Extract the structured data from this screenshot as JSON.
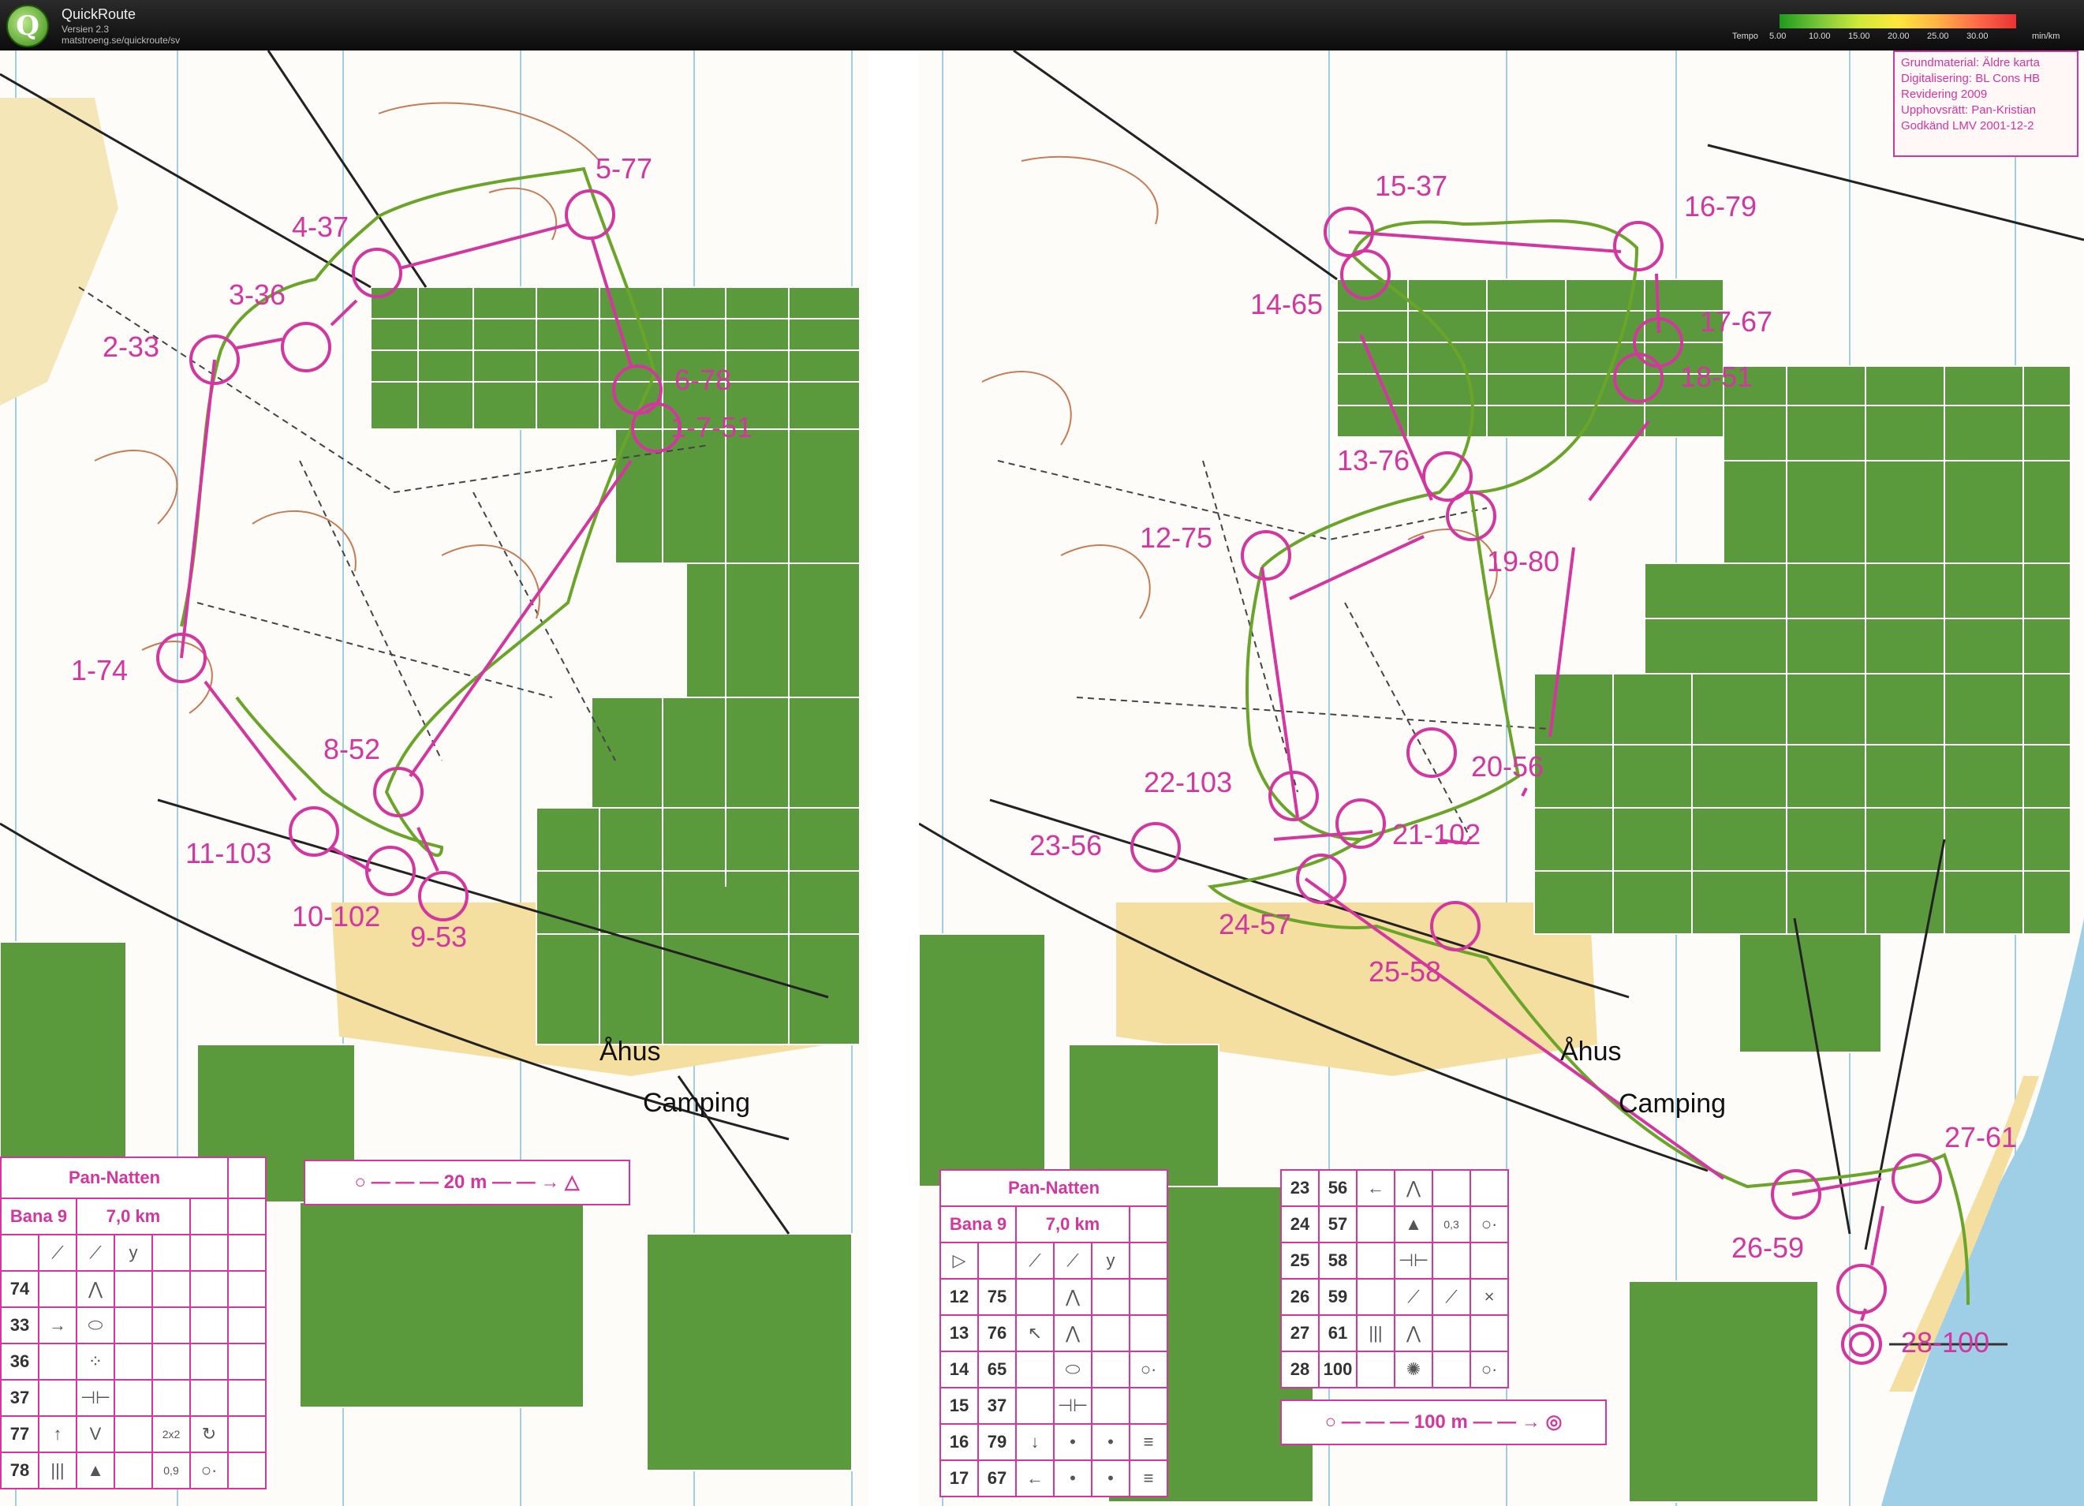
{
  "app": {
    "name": "QuickRoute",
    "version": "Versien 2.3",
    "url": "matstroeng.se/quickroute/sv",
    "logo_letter": "Q"
  },
  "tempo_scale": {
    "label": "Tempo",
    "ticks": [
      "5.00",
      "10.00",
      "15.00",
      "20.00",
      "25.00",
      "30.00"
    ],
    "unit": "min/km"
  },
  "colors": {
    "course_overprint": "#d4369f",
    "route_track": "#6aa52a",
    "forest_green": "#5b9a3c",
    "contour": "#c77b55",
    "water": "#9fcfe6",
    "yellow_open": "#f5dfa0"
  },
  "map_left": {
    "controls": [
      "1-74",
      "2-33",
      "3-36",
      "4-37",
      "5-77",
      "6-78",
      "1-7-51",
      "8-52",
      "9-53",
      "10-102",
      "11-103"
    ],
    "place_names": [
      "Åhus"
    ],
    "map_labels": [
      "Camping"
    ],
    "description": {
      "event": "Pan-Natten",
      "course": "Bana 9",
      "length": "7,0 km",
      "rows": [
        {
          "no": "74",
          "symbols": [
            "⋀"
          ]
        },
        {
          "no": "33",
          "symbols": [
            "→",
            "⬭"
          ]
        },
        {
          "no": "36",
          "symbols": [
            "⁘"
          ]
        },
        {
          "no": "37",
          "symbols": [
            "⊣⊢"
          ]
        },
        {
          "no": "77",
          "symbols": [
            "↑",
            "V",
            "2x2",
            "↻"
          ]
        },
        {
          "no": "78",
          "symbols": [
            "|||",
            "▲",
            "0,9",
            "○·"
          ]
        }
      ],
      "legend": "20 m"
    }
  },
  "map_right": {
    "controls": [
      "12-75",
      "13-76",
      "14-65",
      "15-37",
      "16-79",
      "17-67",
      "18-51",
      "19-80",
      "20-56",
      "21-102",
      "22-103",
      "23-56",
      "24-57",
      "25-58",
      "26-59",
      "27-61",
      "28-100"
    ],
    "place_names": [
      "Åhus"
    ],
    "map_labels": [
      "Camping"
    ],
    "info_box": [
      "Grundmaterial: Äldre karta",
      "Digitalisering: BL Cons HB",
      "Revidering 2009",
      "Upphovsrätt: Pan-Kristian",
      "Godkänd LMV 2001-12-2"
    ],
    "description": {
      "event": "Pan-Natten",
      "course": "Bana 9",
      "length": "7,0 km",
      "rows_a": [
        {
          "seq": "12",
          "no": "75",
          "symbols": [
            "⋀"
          ]
        },
        {
          "seq": "13",
          "no": "76",
          "symbols": [
            "↖",
            "⋀"
          ]
        },
        {
          "seq": "14",
          "no": "65",
          "symbols": [
            "⬭",
            "○·"
          ]
        },
        {
          "seq": "15",
          "no": "37",
          "symbols": [
            "⊣⊢"
          ]
        },
        {
          "seq": "16",
          "no": "79",
          "symbols": [
            "↓",
            "•",
            "•",
            "≡"
          ]
        },
        {
          "seq": "17",
          "no": "67",
          "symbols": [
            "←",
            "•",
            "•",
            "≡"
          ]
        }
      ],
      "rows_b": [
        {
          "seq": "23",
          "no": "56",
          "symbols": [
            "←",
            "⋀"
          ]
        },
        {
          "seq": "24",
          "no": "57",
          "symbols": [
            "▲",
            "0,3",
            "○·"
          ]
        },
        {
          "seq": "25",
          "no": "58",
          "symbols": [
            "⊣⊢"
          ]
        },
        {
          "seq": "26",
          "no": "59",
          "symbols": [
            "⟋",
            "⟋",
            "×"
          ]
        },
        {
          "seq": "27",
          "no": "61",
          "symbols": [
            "|||",
            "⋀"
          ]
        },
        {
          "seq": "28",
          "no": "100",
          "symbols": [
            "✺",
            "○·"
          ]
        }
      ],
      "legend": "100 m"
    }
  }
}
